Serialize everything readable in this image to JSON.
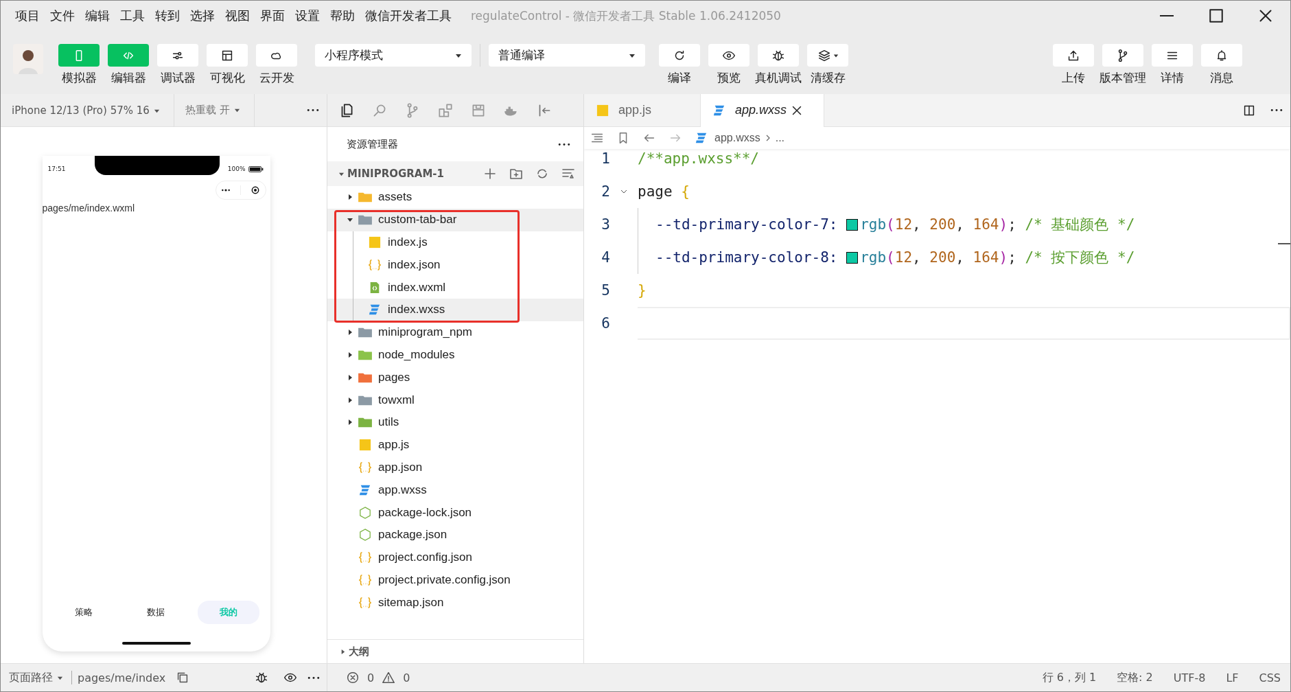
{
  "menu": [
    "项目",
    "文件",
    "编辑",
    "工具",
    "转到",
    "选择",
    "视图",
    "界面",
    "设置",
    "帮助",
    "微信开发者工具"
  ],
  "window": {
    "title": "regulateControl - 微信开发者工具 Stable 1.06.2412050"
  },
  "toolbar": {
    "mode_buttons": [
      {
        "label": "模拟器",
        "on": true
      },
      {
        "label": "编辑器",
        "on": true
      },
      {
        "label": "调试器",
        "on": false
      },
      {
        "label": "可视化",
        "on": false
      },
      {
        "label": "云开发",
        "on": false
      }
    ],
    "mode_select": "小程序模式",
    "compile_select": "普通编译",
    "actions": [
      {
        "label": "编译",
        "menu": false
      },
      {
        "label": "预览",
        "menu": false
      },
      {
        "label": "真机调试",
        "menu": false
      },
      {
        "label": "清缓存",
        "menu": true
      }
    ],
    "right_actions": [
      {
        "label": "上传"
      },
      {
        "label": "版本管理"
      },
      {
        "label": "详情"
      },
      {
        "label": "消息"
      }
    ]
  },
  "simulator": {
    "device": "iPhone 12/13 (Pro) 57% 16",
    "hot_reload": "热重载 开",
    "phone": {
      "time": "17:51",
      "battery": "100%",
      "page_text": "pages/me/index.wxml",
      "tabs": [
        {
          "label": "策略",
          "selected": false
        },
        {
          "label": "数据",
          "selected": false
        },
        {
          "label": "我的",
          "selected": true
        }
      ]
    },
    "page_path_label": "页面路径",
    "page_path": "pages/me/index"
  },
  "explorer": {
    "title": "资源管理器",
    "root": {
      "label": "MINIPROGRAM-1",
      "expanded": true
    },
    "items": [
      {
        "label": "assets",
        "kind": "folder",
        "color": "#f5b82e",
        "expanded": false,
        "selected": false
      },
      {
        "label": "custom-tab-bar",
        "kind": "folder",
        "color": "#8c9aa5",
        "expanded": true,
        "selected": true,
        "boxed": true,
        "children": [
          {
            "label": "index.js",
            "kind": "js",
            "selected": false
          },
          {
            "label": "index.json",
            "kind": "json",
            "selected": false
          },
          {
            "label": "index.wxml",
            "kind": "wxml",
            "selected": false
          },
          {
            "label": "index.wxss",
            "kind": "wxss",
            "selected": true
          }
        ]
      },
      {
        "label": "miniprogram_npm",
        "kind": "folder",
        "color": "#8c9aa5",
        "expanded": false,
        "selected": false
      },
      {
        "label": "node_modules",
        "kind": "folder",
        "color": "#8bc34a",
        "expanded": false,
        "selected": false
      },
      {
        "label": "pages",
        "kind": "folder",
        "color": "#f0703c",
        "expanded": false,
        "selected": false
      },
      {
        "label": "towxml",
        "kind": "folder",
        "color": "#8c9aa5",
        "expanded": false,
        "selected": false
      },
      {
        "label": "utils",
        "kind": "folder",
        "color": "#7cb342",
        "expanded": false,
        "selected": false
      },
      {
        "label": "app.js",
        "kind": "js",
        "selected": false
      },
      {
        "label": "app.json",
        "kind": "json",
        "selected": false
      },
      {
        "label": "app.wxss",
        "kind": "wxss",
        "selected": false
      },
      {
        "label": "package-lock.json",
        "kind": "npm",
        "selected": false
      },
      {
        "label": "package.json",
        "kind": "npm",
        "selected": false
      },
      {
        "label": "project.config.json",
        "kind": "json",
        "selected": false
      },
      {
        "label": "project.private.config.json",
        "kind": "json",
        "selected": false
      },
      {
        "label": "sitemap.json",
        "kind": "json",
        "selected": false
      }
    ],
    "outline": {
      "label": "大纲",
      "expanded": false
    },
    "errors": "0",
    "warnings": "0"
  },
  "editor": {
    "tabs": [
      {
        "label": "app.js",
        "kind": "js",
        "selected": false
      },
      {
        "label": "app.wxss",
        "kind": "wxss",
        "selected": true
      }
    ],
    "breadcrumb": [
      "app.wxss",
      "..."
    ],
    "lines": [
      {
        "number": "1",
        "current": false,
        "tokens": [
          {
            "text": "/**app.wxss**/",
            "kind": "comment"
          }
        ]
      },
      {
        "number": "2",
        "current": false,
        "folded": false,
        "tokens": [
          {
            "text": "page ",
            "kind": "selector"
          },
          {
            "text": "{",
            "kind": "brace"
          }
        ],
        "children": [
          {
            "number": "3",
            "current": false,
            "tokens": [
              {
                "text": "--td-primary-color-7: ",
                "kind": "property"
              },
              {
                "kind": "swatch",
                "color": "#0cc8a4"
              },
              {
                "text": "rgb",
                "kind": "func"
              },
              {
                "text": "(",
                "kind": "paren"
              },
              {
                "text": "12",
                "kind": "number"
              },
              {
                "text": ", ",
                "kind": "punct"
              },
              {
                "text": "200",
                "kind": "number"
              },
              {
                "text": ", ",
                "kind": "punct"
              },
              {
                "text": "164",
                "kind": "number"
              },
              {
                "text": ")",
                "kind": "paren"
              },
              {
                "text": "; ",
                "kind": "punct"
              },
              {
                "text": "/* 基础颜色 */",
                "kind": "comment"
              }
            ]
          },
          {
            "number": "4",
            "current": false,
            "tokens": [
              {
                "text": "--td-primary-color-8: ",
                "kind": "property"
              },
              {
                "kind": "swatch",
                "color": "#0cc8a4"
              },
              {
                "text": "rgb",
                "kind": "func"
              },
              {
                "text": "(",
                "kind": "paren"
              },
              {
                "text": "12",
                "kind": "number"
              },
              {
                "text": ", ",
                "kind": "punct"
              },
              {
                "text": "200",
                "kind": "number"
              },
              {
                "text": ", ",
                "kind": "punct"
              },
              {
                "text": "164",
                "kind": "number"
              },
              {
                "text": ")",
                "kind": "paren"
              },
              {
                "text": "; ",
                "kind": "punct"
              },
              {
                "text": "/* 按下颜色 */",
                "kind": "comment"
              }
            ]
          }
        ]
      },
      {
        "number": "5",
        "current": false,
        "tokens": [
          {
            "text": "}",
            "kind": "brace"
          }
        ]
      },
      {
        "number": "6",
        "current": true
      }
    ]
  },
  "status": {
    "position": "行 6，列 1",
    "indent": "空格: 2",
    "encoding": "UTF-8",
    "eol": "LF",
    "language": "CSS"
  }
}
